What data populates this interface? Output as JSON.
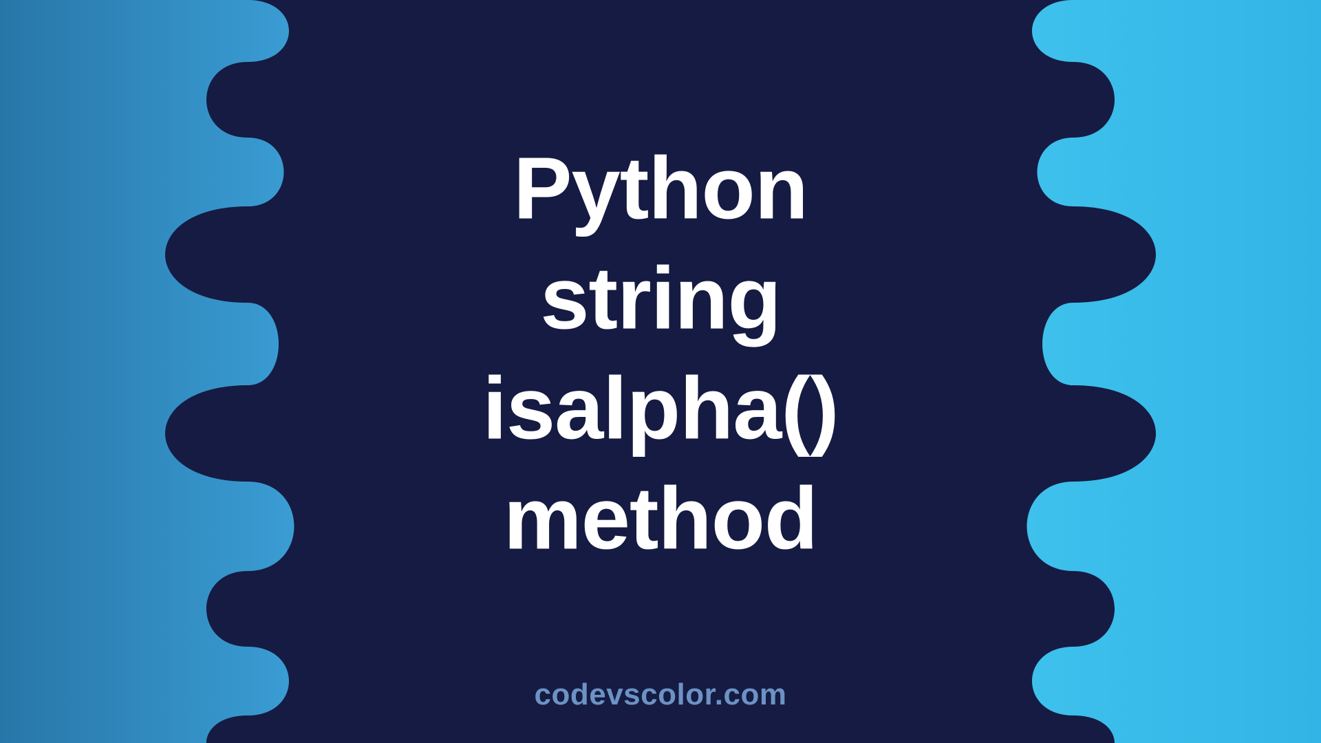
{
  "title_lines": [
    "Python",
    "string",
    "isalpha()",
    "method"
  ],
  "brand": "codevscolor.com",
  "colors": {
    "dark_navy": "#151b42",
    "left_blue_start": "#2876a8",
    "left_blue_end": "#3a9dd4",
    "right_blue_start": "#3fc1ed",
    "right_blue_end": "#32b4e6",
    "title_text": "#ffffff",
    "brand_text": "#6d92c4"
  }
}
